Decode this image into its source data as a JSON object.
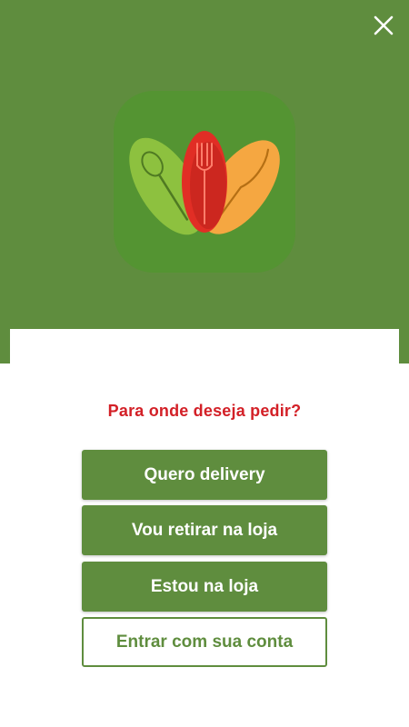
{
  "colors": {
    "header_bg": "#5f8d3e",
    "logo_tile_bg": "#549432",
    "question_text": "#d32027",
    "button_green": "#5f8d3e"
  },
  "header": {
    "close_icon": "close-icon",
    "logo_icon": "app-logo-spoon-fork-knife"
  },
  "prompt": {
    "question": "Para onde deseja pedir?"
  },
  "options": {
    "delivery": "Quero delivery",
    "pickup": "Vou retirar na loja",
    "in_store": "Estou na loja",
    "login": "Entrar com sua conta"
  }
}
